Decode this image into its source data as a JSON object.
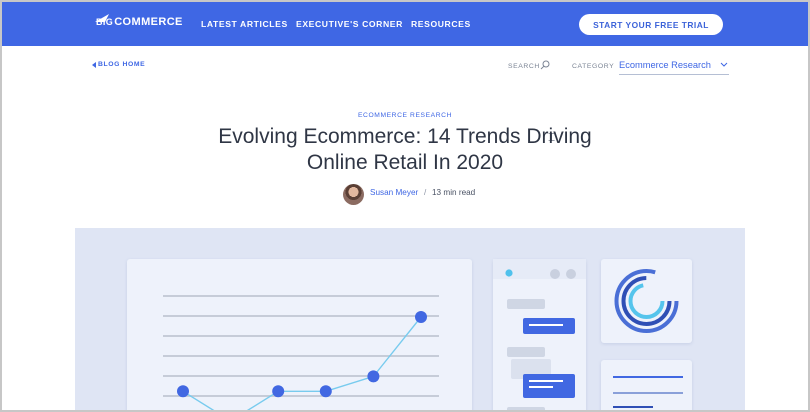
{
  "brand": {
    "logo_prefix": "BIG",
    "logo_suffix": "COMMERCE",
    "primary_color": "#3f67e4"
  },
  "nav": {
    "links": [
      "LATEST ARTICLES",
      "EXECUTIVE'S CORNER",
      "RESOURCES"
    ],
    "cta_label": "START YOUR FREE TRIAL"
  },
  "subbar": {
    "back_label": "BLOG HOME",
    "search_label": "SEARCH",
    "category_label": "CATEGORY",
    "category_value": "Ecommerce Research"
  },
  "article": {
    "kicker": "ECOMMERCE RESEARCH",
    "title_line1": "Evolving Ecommerce: 14 Trends Driving",
    "title_line2": "Online Retail In 2020",
    "author": "Susan Meyer",
    "separator": "/",
    "read_time": "13 min read"
  },
  "hero_chart": {
    "type": "line",
    "values": [
      2,
      0,
      2,
      2,
      3,
      7
    ],
    "line_color": "#78cbee",
    "point_color": "#4168e2",
    "grid_color": "#c6ccd8"
  },
  "icons": {
    "search": "search-icon",
    "back": "caret-left-icon",
    "category": "chevron-down-icon"
  }
}
